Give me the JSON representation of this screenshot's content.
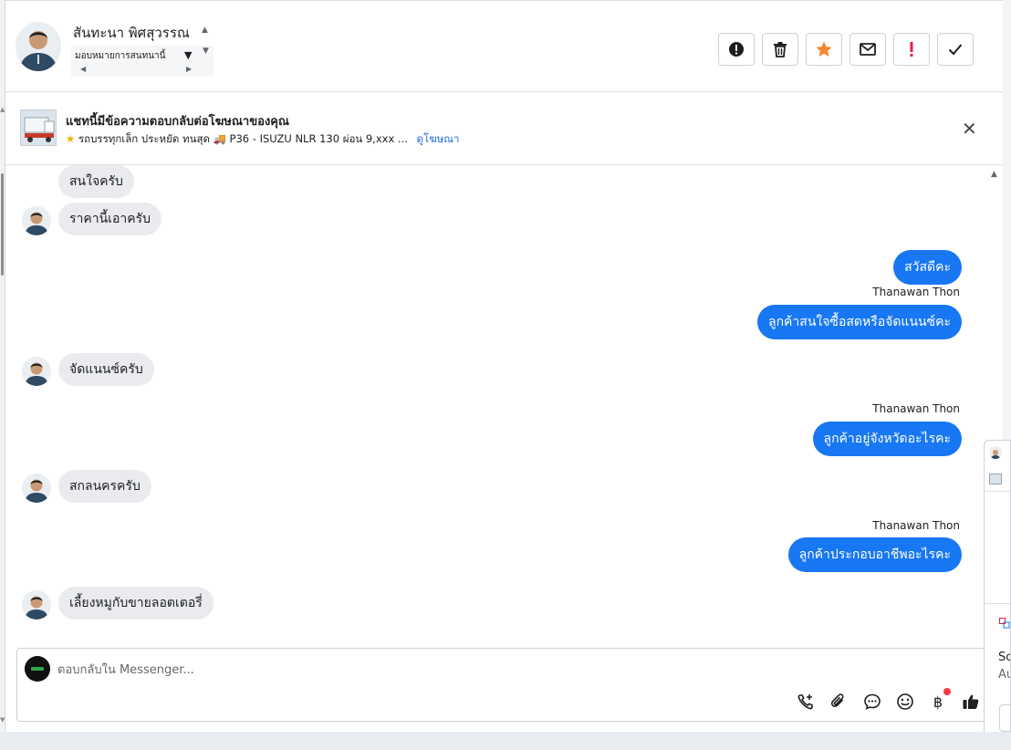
{
  "contact": {
    "name": "สันทะนา พิศสุวรรณ",
    "assign_label": "มอบหมายการสนทนานี้"
  },
  "actions": [
    {
      "name": "report-button",
      "icon": "exclamation-circle-icon"
    },
    {
      "name": "delete-button",
      "icon": "trash-icon"
    },
    {
      "name": "star-button",
      "icon": "star-icon"
    },
    {
      "name": "mark-unread-button",
      "icon": "envelope-icon"
    },
    {
      "name": "follow-up-button",
      "icon": "exclamation-icon"
    },
    {
      "name": "mark-done-button",
      "icon": "checkmark-icon"
    }
  ],
  "ad": {
    "title": "แชทนี้มีข้อความตอบกลับต่อโฆษณาของคุณ",
    "subtitle": "รถบรรทุกเล็ก ประหยัด ทนสุด 🚚 P36 - ISUZU NLR 130 ผ่อน 9,xxx ...",
    "link": "ดูโฆษณา"
  },
  "messages": [
    {
      "dir": "in",
      "text": "สนใจครับ",
      "avatar": false
    },
    {
      "dir": "in",
      "text": "ราคานี้เอาครับ",
      "avatar": true
    },
    {
      "dir": "out",
      "text": "สวัสดีคะ"
    },
    {
      "dir": "out",
      "sender": "Thanawan Thon",
      "text": "ลูกค้าสนใจซื้อสดหรือจัดแนนซ์คะ"
    },
    {
      "dir": "in",
      "text": "จัดแนนซ์ครับ",
      "avatar": true
    },
    {
      "dir": "out",
      "sender": "Thanawan Thon",
      "text": "ลูกค้าอยู่จังหวัดอะไรคะ"
    },
    {
      "dir": "in",
      "text": "สกลนครครับ",
      "avatar": true
    },
    {
      "dir": "out",
      "sender": "Thanawan Thon",
      "text": "ลูกค้าประกอบอาชีพอะไรคะ"
    },
    {
      "dir": "in",
      "text": "เลี้ยงหมูกับขายลอตเตอรี่",
      "avatar": true
    }
  ],
  "composer": {
    "placeholder": "ตอบกลับใน Messenger...",
    "tools": [
      "add-call-icon",
      "attachment-icon",
      "saved-reply-icon",
      "emoji-icon",
      "baht-payment-icon",
      "thumbs-up-icon"
    ],
    "payment_label": "฿"
  },
  "side_overlay": {
    "text_line1": "Sc",
    "text_line2": "Au"
  },
  "colors": {
    "accent": "#1877f2",
    "star": "#f5862c",
    "alert": "#e41e3f"
  }
}
